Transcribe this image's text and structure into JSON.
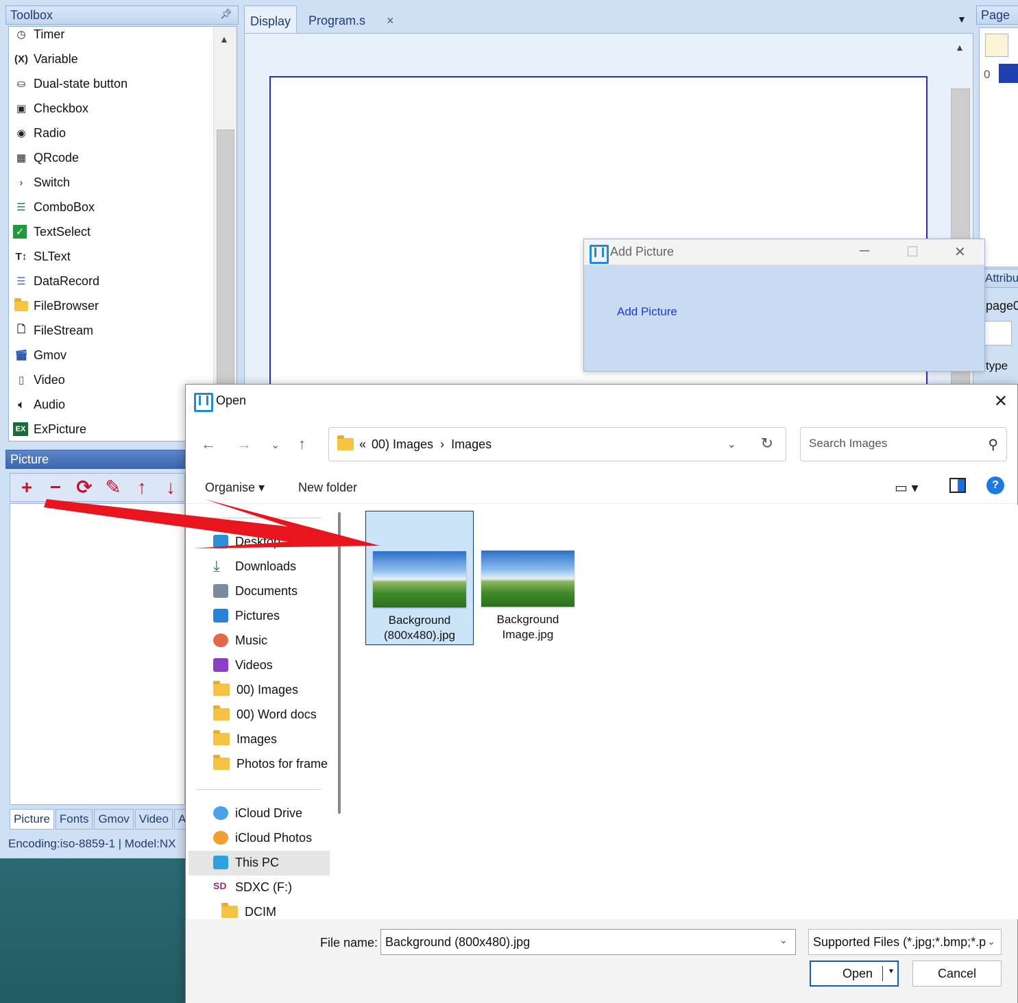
{
  "toolbox": {
    "title": "Toolbox",
    "items": [
      {
        "label": "Timer",
        "icon": "clock-icon"
      },
      {
        "label": "Variable",
        "icon": "variable-icon"
      },
      {
        "label": "Dual-state button",
        "icon": "dual-state-icon"
      },
      {
        "label": "Checkbox",
        "icon": "checkbox-icon"
      },
      {
        "label": "Radio",
        "icon": "radio-icon"
      },
      {
        "label": "QRcode",
        "icon": "qrcode-icon"
      },
      {
        "label": "Switch",
        "icon": "switch-icon"
      },
      {
        "label": "ComboBox",
        "icon": "combobox-icon"
      },
      {
        "label": "TextSelect",
        "icon": "textselect-icon"
      },
      {
        "label": "SLText",
        "icon": "sltext-icon"
      },
      {
        "label": "DataRecord",
        "icon": "datarecord-icon"
      },
      {
        "label": "FileBrowser",
        "icon": "folder-icon"
      },
      {
        "label": "FileStream",
        "icon": "file-icon"
      },
      {
        "label": "Gmov",
        "icon": "gmov-icon"
      },
      {
        "label": "Video",
        "icon": "video-icon"
      },
      {
        "label": "Audio",
        "icon": "audio-icon"
      },
      {
        "label": "ExPicture",
        "icon": "expicture-icon"
      }
    ]
  },
  "picture_panel": {
    "title": "Picture",
    "tabs": [
      "Picture",
      "Fonts",
      "Gmov",
      "Video",
      "A"
    ]
  },
  "status": "Encoding:iso-8859-1 | Model:NX",
  "editor": {
    "tabs": [
      "Display",
      "Program.s"
    ],
    "close_glyph": "×"
  },
  "page_panel": {
    "title": "Page",
    "index": "0"
  },
  "attribute_panel": {
    "title": "Attribut",
    "value": "page0",
    "type_label": "type"
  },
  "add_picture": {
    "title": "Add Picture",
    "link": "Add Picture"
  },
  "open_dialog": {
    "title": "Open",
    "breadcrumb": {
      "prefix": "«",
      "parent": "00) Images",
      "separator": "›",
      "current": "Images"
    },
    "search_placeholder": "Search Images",
    "organise": "Organise ▾",
    "new_folder": "New folder",
    "nav": {
      "quick": [
        {
          "label": "Desktop",
          "icon": "desktop-icon",
          "color": "#2d8fd8"
        },
        {
          "label": "Downloads",
          "icon": "download-icon",
          "color": "#1b8a3c"
        },
        {
          "label": "Documents",
          "icon": "documents-icon",
          "color": "#7a8aa0"
        },
        {
          "label": "Pictures",
          "icon": "pictures-icon",
          "color": "#2a82d6"
        },
        {
          "label": "Music",
          "icon": "music-icon",
          "color": "#e3674a"
        },
        {
          "label": "Videos",
          "icon": "videos-icon",
          "color": "#8b3fc4"
        },
        {
          "label": "00) Images",
          "icon": "folder-icon",
          "color": "#f5c242"
        },
        {
          "label": "00) Word docs",
          "icon": "folder-icon",
          "color": "#f5c242"
        },
        {
          "label": "Images",
          "icon": "folder-icon",
          "color": "#f5c242"
        },
        {
          "label": "Photos for frame",
          "icon": "folder-icon",
          "color": "#f5c242"
        }
      ],
      "places": [
        {
          "label": "iCloud Drive",
          "icon": "icloud-drive-icon",
          "color": "#4aa3e8"
        },
        {
          "label": "iCloud Photos",
          "icon": "icloud-photos-icon",
          "color": "#f0a030"
        },
        {
          "label": "This PC",
          "icon": "this-pc-icon",
          "color": "#2fa0e0"
        },
        {
          "label": "SDXC (F:)",
          "icon": "sdxc-icon",
          "color": "#9b2a7a"
        },
        {
          "label": "DCIM",
          "icon": "folder-icon",
          "color": "#f5c242"
        }
      ]
    },
    "files": [
      {
        "line1": "Background",
        "line2": "(800x480).jpg",
        "selected": true
      },
      {
        "line1": "Background",
        "line2": "Image.jpg",
        "selected": false
      }
    ],
    "file_name_label": "File name:",
    "file_name_value": "Background (800x480).jpg",
    "filter": "Supported Files (*.jpg;*.bmp;*.p",
    "open_label": "Open",
    "cancel_label": "Cancel"
  },
  "colors": {
    "annotation_arrow": "#e8141e",
    "selection": "#cce4f7",
    "accent": "#0f5cc9"
  }
}
